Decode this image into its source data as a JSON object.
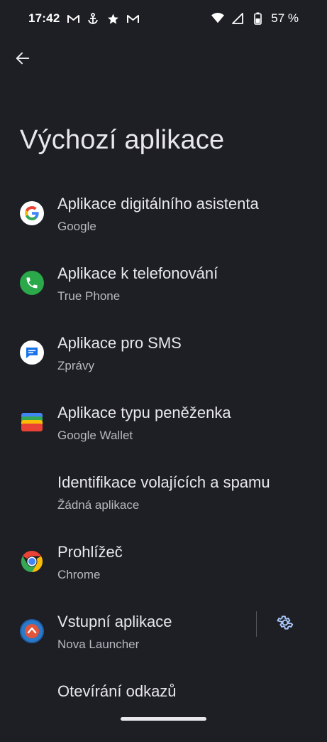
{
  "status_bar": {
    "time": "17:42",
    "notification_icons": [
      "gmail-icon",
      "anchor-icon",
      "star-icon",
      "gmail-icon"
    ],
    "system_icons": [
      "wifi-icon",
      "cellular-icon",
      "battery-icon"
    ],
    "battery_percent": "57 %"
  },
  "header": {
    "back_icon": "arrow-back-icon",
    "title": "Výchozí aplikace"
  },
  "items": [
    {
      "title": "Aplikace digitálního asistenta",
      "subtitle": "Google",
      "icon": "google-icon"
    },
    {
      "title": "Aplikace k telefonování",
      "subtitle": "True Phone",
      "icon": "phone-icon"
    },
    {
      "title": "Aplikace pro SMS",
      "subtitle": "Zprávy",
      "icon": "messages-icon"
    },
    {
      "title": "Aplikace typu peněženka",
      "subtitle": "Google Wallet",
      "icon": "wallet-icon"
    },
    {
      "title": "Identifikace volajících a spamu",
      "subtitle": "Žádná aplikace",
      "icon": ""
    },
    {
      "title": "Prohlížeč",
      "subtitle": "Chrome",
      "icon": "chrome-icon"
    },
    {
      "title": "Vstupní aplikace",
      "subtitle": "Nova Launcher",
      "icon": "nova-launcher-icon",
      "action_icon": "gear-icon"
    },
    {
      "title": "Otevírání odkazů",
      "subtitle": "",
      "icon": ""
    }
  ],
  "colors": {
    "background": "#1d1f24",
    "accent": "#a8c7fa",
    "phone_green": "#2aa84a",
    "messages_blue": "#1a73e8"
  }
}
